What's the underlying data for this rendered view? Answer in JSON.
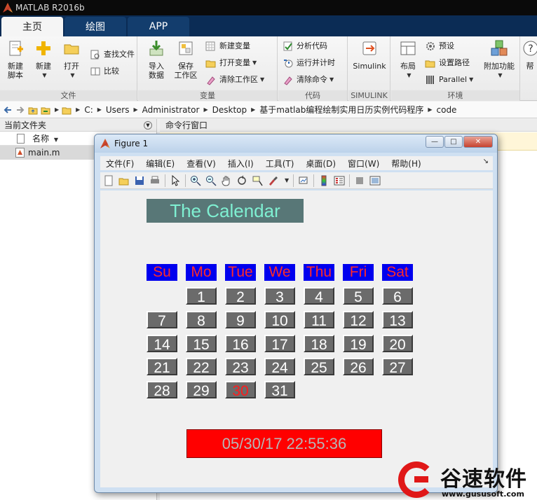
{
  "window": {
    "title": "MATLAB R2016b"
  },
  "tabs": [
    {
      "label": "主页"
    },
    {
      "label": "绘图"
    },
    {
      "label": "APP"
    }
  ],
  "ribbon": {
    "file_group": {
      "label": "文件",
      "new_script": "新建\n脚本",
      "new": "新建",
      "open": "打开",
      "find_files": "查找文件",
      "compare": "比较"
    },
    "variable_group": {
      "label": "变量",
      "import_data": "导入\n数据",
      "save_workspace": "保存\n工作区",
      "new_variable": "新建变量",
      "open_variable": "打开变量",
      "clear_workspace": "清除工作区"
    },
    "code_group": {
      "label": "代码",
      "analyze_code": "分析代码",
      "run_and_time": "运行并计时",
      "clear_commands": "清除命令"
    },
    "simulink_group": {
      "label": "SIMULINK",
      "simulink": "Simulink"
    },
    "environment_group": {
      "label": "环境",
      "layout": "布局",
      "preferences": "预设",
      "set_path": "设置路径",
      "parallel": "Parallel",
      "addons": "附加功能"
    },
    "help_partial": "帮"
  },
  "address": {
    "crumbs": [
      "C:",
      "Users",
      "Administrator",
      "Desktop",
      "基于matlab编程绘制实用日历实例代码程序",
      "code"
    ]
  },
  "current_folder": {
    "title": "当前文件夹",
    "name_col": "名称",
    "files": [
      "main.m"
    ]
  },
  "command_window": {
    "title": "命令行窗口"
  },
  "figure": {
    "title": "Figure 1",
    "menu": [
      "文件(F)",
      "编辑(E)",
      "查看(V)",
      "插入(I)",
      "工具(T)",
      "桌面(D)",
      "窗口(W)",
      "帮助(H)"
    ],
    "calendar": {
      "heading": "The Calendar",
      "weekdays": [
        "Su",
        "Mo",
        "Tue",
        "We",
        "Thu",
        "Fri",
        "Sat"
      ],
      "days": [
        [
          "",
          "1",
          "2",
          "3",
          "4",
          "5",
          "6"
        ],
        [
          "7",
          "8",
          "9",
          "10",
          "11",
          "12",
          "13"
        ],
        [
          "14",
          "15",
          "16",
          "17",
          "18",
          "19",
          "20"
        ],
        [
          "21",
          "22",
          "23",
          "24",
          "25",
          "26",
          "27"
        ],
        [
          "28",
          "29",
          "30",
          "31",
          "",
          "",
          ""
        ]
      ],
      "highlight_day": "30",
      "datetime": "05/30/17 22:55:36"
    }
  },
  "watermark": {
    "brand": "谷速软件",
    "url": "www.gususoft.com"
  },
  "colors": {
    "heading_bg": "#587777",
    "heading_text": "#7ff0d2",
    "weekday_bg": "#0000ee",
    "weekday_text": "#ff2a2a",
    "day_bg": "#6b6b6b",
    "today_text": "#ff1c1c",
    "clock_bg": "#ff0000"
  }
}
